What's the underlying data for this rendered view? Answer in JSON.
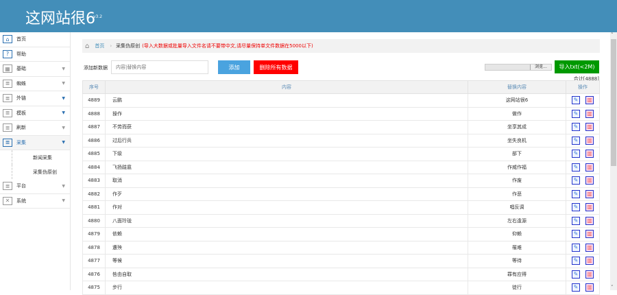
{
  "header": {
    "title": "这网站很6",
    "version": "v3.2"
  },
  "sidebar": {
    "items": [
      {
        "label": "首页",
        "icon": "home-icon"
      },
      {
        "label": "帮助",
        "icon": "help-icon"
      },
      {
        "label": "基础",
        "icon": "grid-icon"
      },
      {
        "label": "蜘蛛",
        "icon": "doc-icon"
      },
      {
        "label": "外链",
        "icon": "doc-icon"
      },
      {
        "label": "模板",
        "icon": "doc-icon"
      },
      {
        "label": "刷新",
        "icon": "doc-icon"
      },
      {
        "label": "采集",
        "icon": "doc-icon"
      },
      {
        "label": "平台",
        "icon": "doc-icon"
      },
      {
        "label": "系统",
        "icon": "tools-icon"
      }
    ],
    "subitems": [
      "新闻采集",
      "采集伪原创"
    ]
  },
  "breadcrumb": {
    "home": "首页",
    "current": "采集伪原创",
    "note": "(导入大数据或批量导入文件名请不要带中文,请尽量保持单文件数据在5000以下)"
  },
  "toolbar": {
    "add_label": "添加新数据",
    "input_placeholder": "内容|替换内容",
    "add_button": "添加",
    "delete_all_button": "删除所有数据",
    "browse_button": "浏览...",
    "import_button": "导入txt(<2M)",
    "total": "合计[4888]"
  },
  "table": {
    "headers": [
      "序号",
      "内容",
      "替换内容",
      "操作"
    ],
    "rows": [
      [
        "4889",
        "云鹏",
        "这网站很6"
      ],
      [
        "4888",
        "操作",
        "做作"
      ],
      [
        "4887",
        "不劳而获",
        "坐享其成"
      ],
      [
        "4886",
        "过后行兵",
        "坐失良机"
      ],
      [
        "4885",
        "下级",
        "部下"
      ],
      [
        "4884",
        "飞扬跋扈",
        "作威作福"
      ],
      [
        "4883",
        "取消",
        "作废"
      ],
      [
        "4882",
        "作歹",
        "作恶"
      ],
      [
        "4881",
        "作对",
        "唱反调"
      ],
      [
        "4880",
        "八面玲珑",
        "左右逢源"
      ],
      [
        "4879",
        "依赖",
        "仰赖"
      ],
      [
        "4878",
        "遭殃",
        "罹难"
      ],
      [
        "4877",
        "等候",
        "等待"
      ],
      [
        "4876",
        "咎由自取",
        "罪有应得"
      ],
      [
        "4875",
        "步行",
        "徒行"
      ]
    ]
  },
  "colors": {
    "header": "#438eb9",
    "add": "#4aa3df",
    "delete": "#ff0000",
    "import": "#009900"
  }
}
